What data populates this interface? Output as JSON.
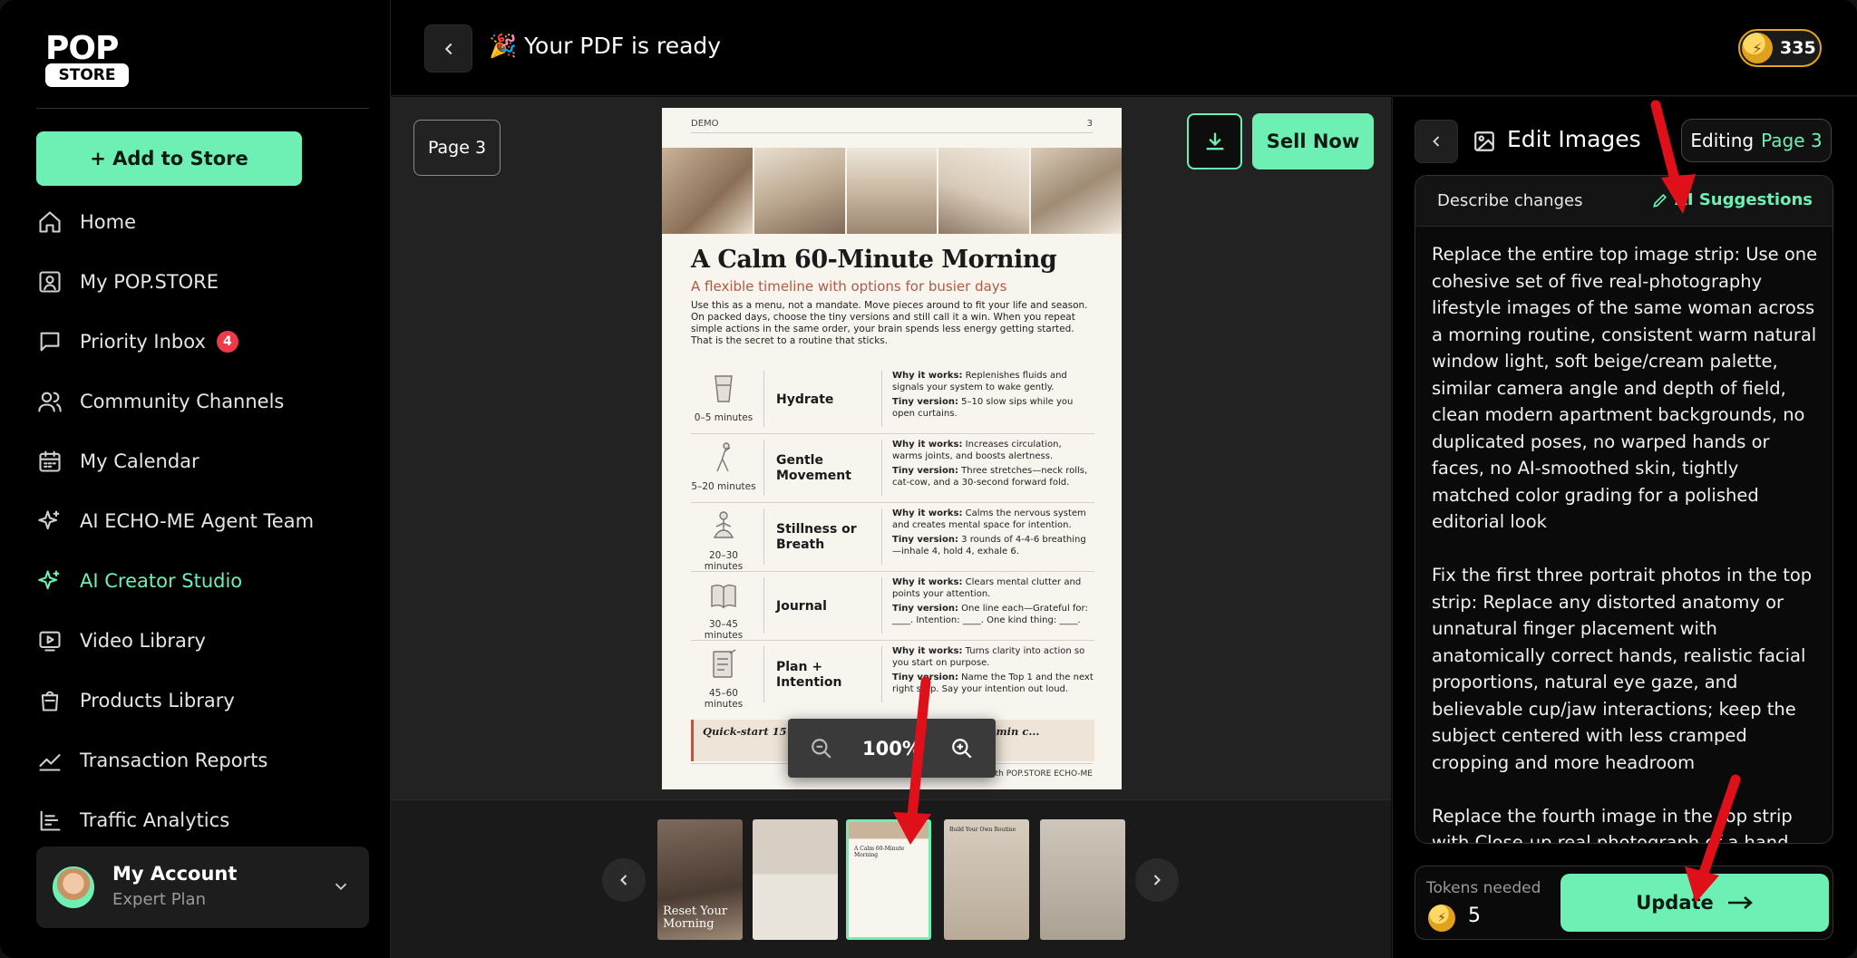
{
  "app": {
    "brand_top": "POP",
    "brand_bottom": "STORE"
  },
  "sidebar": {
    "add_button": "+ Add to Store",
    "items": [
      {
        "label": "Home",
        "icon": "home-icon"
      },
      {
        "label": "My POP.STORE",
        "icon": "store-icon"
      },
      {
        "label": "Priority Inbox",
        "icon": "inbox-icon",
        "badge": "4"
      },
      {
        "label": "Community Channels",
        "icon": "users-icon"
      },
      {
        "label": "My Calendar",
        "icon": "calendar-icon"
      },
      {
        "label": "AI ECHO-ME Agent Team",
        "icon": "sparkle-icon"
      },
      {
        "label": "AI Creator Studio",
        "icon": "sparkle-icon",
        "active": true
      },
      {
        "label": "Video Library",
        "icon": "video-icon"
      },
      {
        "label": "Products Library",
        "icon": "bag-icon"
      },
      {
        "label": "Transaction Reports",
        "icon": "chart-icon"
      },
      {
        "label": "Traffic Analytics",
        "icon": "analytics-icon"
      }
    ],
    "account": {
      "name": "My Account",
      "plan": "Expert Plan"
    }
  },
  "header": {
    "title": "🎉 Your PDF is ready",
    "token_balance": "335"
  },
  "preview": {
    "page_label": "Page 3",
    "sell_button": "Sell Now",
    "zoom_level": "100%",
    "document": {
      "running_head": "DEMO",
      "page_number": "3",
      "title": "A Calm 60-Minute Morning",
      "subtitle": "A flexible timeline with options for busier days",
      "intro": "Use this as a menu, not a mandate. Move pieces around to fit your life and season. On packed days, choose the tiny versions and still call it a win. When you repeat simple actions in the same order, your brain spends less energy getting started. That is the secret to a routine that sticks.",
      "why_label": "Why it works:",
      "tiny_label": "Tiny version:",
      "rows": [
        {
          "minutes": "0–5 minutes",
          "name": "Hydrate",
          "why": "Replenishes fluids and signals your system to wake gently.",
          "tiny": "5–10 slow sips while you open curtains."
        },
        {
          "minutes": "5–20 minutes",
          "name": "Gentle Movement",
          "why": "Increases circulation, warms joints, and boosts alertness.",
          "tiny": "Three stretches—neck rolls, cat-cow, and a 30-second forward fold."
        },
        {
          "minutes": "20–30 minutes",
          "name": "Stillness or Breath",
          "why": "Calms the nervous system and creates mental space for intention.",
          "tiny": "3 rounds of 4-4-6 breathing—inhale 4, hold 4, exhale 6."
        },
        {
          "minutes": "30–45 minutes",
          "name": "Journal",
          "why": "Clears mental clutter and points your attention.",
          "tiny": "One line each—Grateful for: ____. Intention: ____. One kind thing: ____."
        },
        {
          "minutes": "45–60 minutes",
          "name": "Plan + Intention",
          "why": "Turns clarity into action so you start on purpose.",
          "tiny": "Name the Top 1 and the next right step. Say your intention out loud."
        }
      ],
      "quick_start": "Quick-start 15 min ... in breathe, 3 min journal, 2 min c...",
      "footer": "...with POP.STORE ECHO-ME"
    },
    "thumbnails": [
      {
        "caption": "Reset Your Morning"
      },
      {
        "caption": ""
      },
      {
        "caption": "A Calm 60-Minute Morning"
      },
      {
        "caption": "Build Your Own Routine"
      },
      {
        "caption": ""
      }
    ]
  },
  "edit_panel": {
    "title": "Edit Images",
    "editing_label": "Editing",
    "editing_page": "Page 3",
    "describe_label": "Describe changes",
    "ai_suggestions": "AI Suggestions",
    "instructions": [
      "Replace the entire top image strip: Use one cohesive set of five real-photography lifestyle images of the same woman across a morning routine, consistent warm natural window light, soft beige/cream palette, similar camera angle and depth of field, clean modern apartment backgrounds, no duplicated poses, no warped hands or faces, no AI-smoothed skin, tightly matched color grading for a polished editorial look",
      "Fix the first three portrait photos in the top strip: Replace any distorted anatomy or unnatural finger placement with anatomically correct hands, realistic facial proportions, natural eye gaze, and believable cup/jaw interactions; keep the subject centered with less cramped cropping and more headroom",
      "Replace the fourth image in the top strip with Close-up real photograph of a hand"
    ],
    "tokens_needed_label": "Tokens needed",
    "tokens_needed": "5",
    "update_button": "Update"
  },
  "colors": {
    "accent": "#6ef0b4",
    "badge": "#ef3a4b",
    "coin": "#e4a51b",
    "annotation": "#e0101a"
  }
}
